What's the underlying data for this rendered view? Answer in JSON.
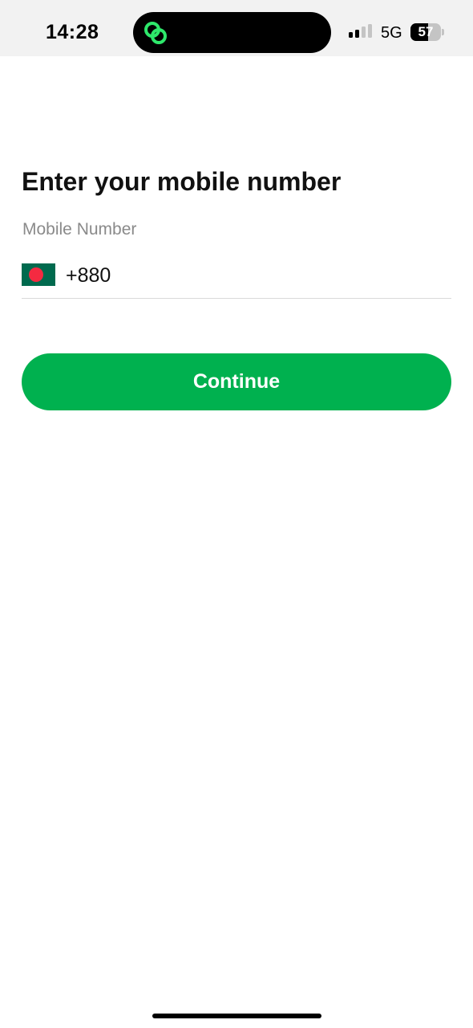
{
  "status_bar": {
    "time": "14:28",
    "network": "5G",
    "battery_level": "57",
    "battery_fraction": 0.57,
    "island_icon": "linked-rings-icon",
    "accent_color": "#2ee86b"
  },
  "main": {
    "title": "Enter your mobile number",
    "field_label": "Mobile Number",
    "country_flag": "bangladesh-flag-icon",
    "country_code": "+880",
    "continue_label": "Continue"
  },
  "colors": {
    "primary": "#00b14f",
    "flag_green": "#006a4e",
    "flag_red": "#f42a41",
    "label_gray": "#8a8a8a"
  }
}
